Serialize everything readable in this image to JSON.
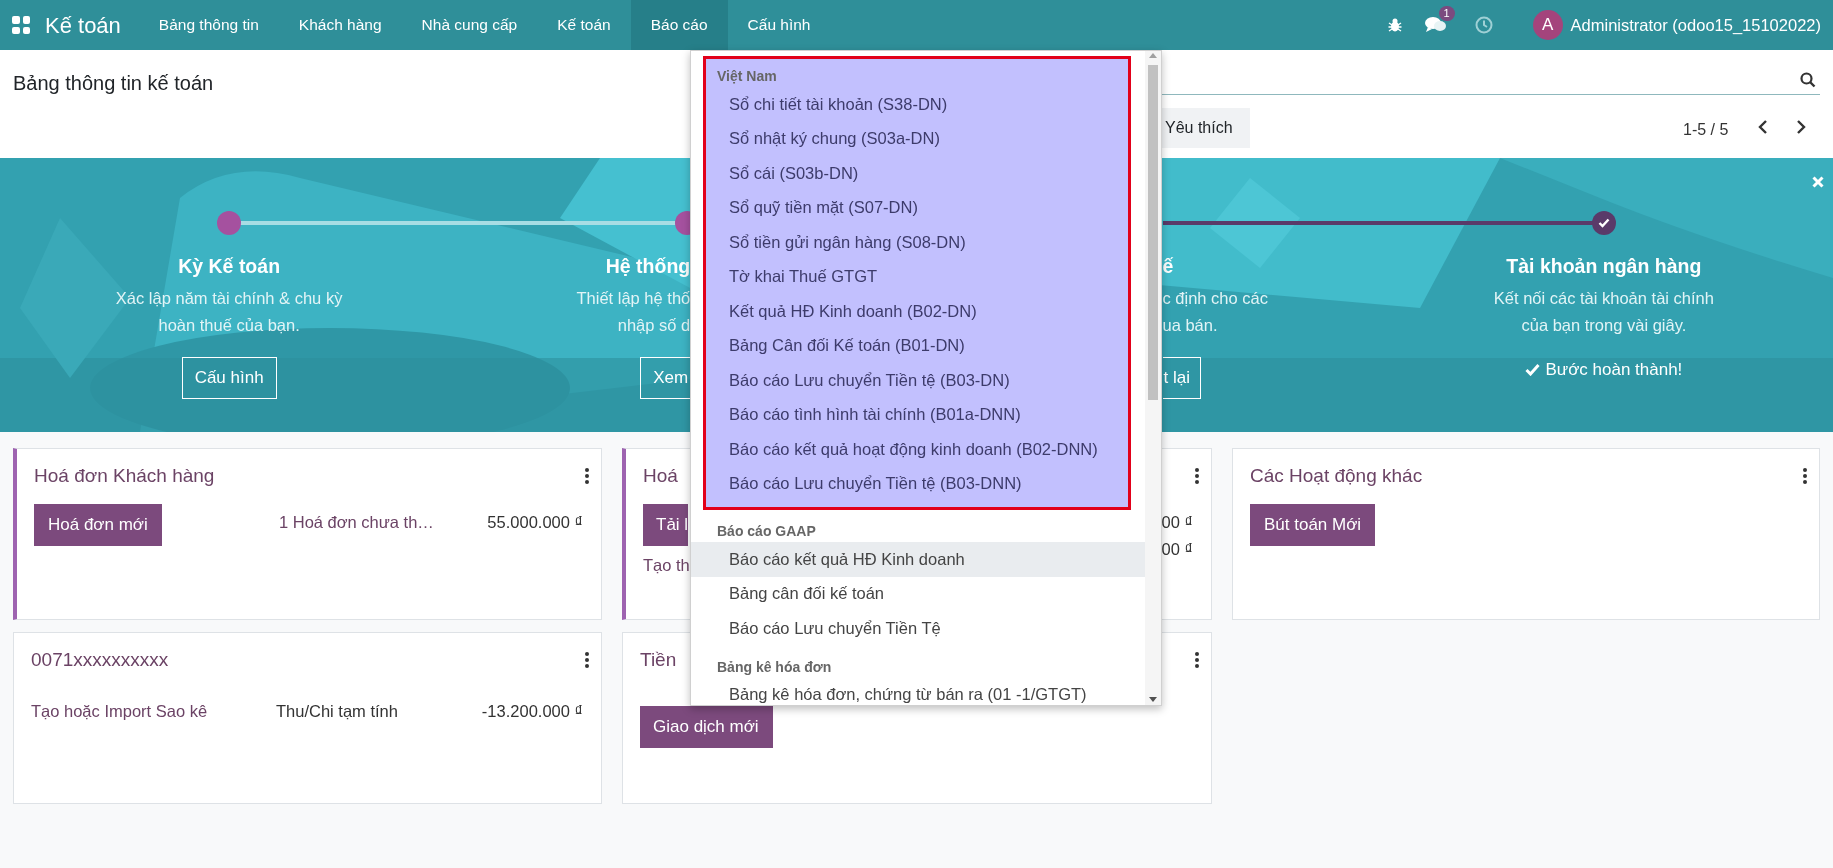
{
  "topbar": {
    "app_title": "Kế toán",
    "menu": [
      {
        "label": "Bảng thông tin",
        "selected": false
      },
      {
        "label": "Khách hàng",
        "selected": false
      },
      {
        "label": "Nhà cung cấp",
        "selected": false
      },
      {
        "label": "Kế toán",
        "selected": false
      },
      {
        "label": "Báo cáo",
        "selected": true
      },
      {
        "label": "Cấu hình",
        "selected": false
      }
    ],
    "message_count": "1",
    "avatar_letter": "A",
    "user": "Administrator (odoo15_15102022)"
  },
  "control_panel": {
    "title": "Bảng thông tin kế toán",
    "favorites": "Yêu thích",
    "pager": "1-5 / 5"
  },
  "banner": {
    "steps": [
      {
        "title": "Kỳ Kế toán",
        "lines": [
          "Xác lập năm tài chính & chu kỳ",
          "hoàn thuế của bạn."
        ],
        "button": "Cấu hình",
        "done": false
      },
      {
        "title": "Hệ thống",
        "lines": [
          "Thiết lập hệ thố",
          "nhập số d"
        ],
        "button": "Xem",
        "done": false,
        "clipped_right": true
      },
      {
        "title": "ế",
        "lines": [
          "c định cho các",
          "ua bán."
        ],
        "button": "t lại",
        "clipped_left": true
      },
      {
        "title": "Tài khoản ngân hàng",
        "lines": [
          "Kết nối các tài khoản tài chính",
          "của bạn trong vài giây."
        ],
        "done_text": "Bước hoàn thành!",
        "done": true
      }
    ]
  },
  "cards": [
    {
      "title": "Hoá đơn Khách hàng",
      "accent": true,
      "button": "Hoá đơn mới",
      "rows": [
        {
          "label": "1 Hoá đơn chưa th…",
          "amount": "55.000.000 ₫"
        }
      ]
    },
    {
      "title": "Hoá",
      "accent": true,
      "button": "Tải l",
      "link": "Tạo th",
      "rows": [
        {
          "amount": "00 ₫"
        },
        {
          "amount": "00 ₫"
        }
      ],
      "clipped_right": true
    },
    {
      "title": "Các Hoạt động khác",
      "accent": false,
      "button": "Bút toán Mới"
    },
    {
      "title": "0071xxxxxxxxxx",
      "accent": false,
      "link": "Tạo hoặc Import Sao kê",
      "rows": [
        {
          "label": "Thu/Chi tạm tính",
          "amount": "-13.200.000 ₫"
        }
      ]
    },
    {
      "title": "Tiền",
      "accent": false,
      "button": "Giao dịch mới",
      "clipped_right": true
    }
  ],
  "dropdown": {
    "sections": [
      {
        "header": "Việt Nam",
        "highlighted": true,
        "items": [
          {
            "label": "Sổ chi tiết tài khoản (S38-DN)",
            "hovered": false
          },
          {
            "label": "Sổ nhật ký chung (S03a-DN)",
            "hovered": false
          },
          {
            "label": "Sổ cái (S03b-DN)",
            "hovered": false
          },
          {
            "label": "Sổ quỹ tiền mặt (S07-DN)",
            "hovered": false
          },
          {
            "label": "Sổ tiền gửi ngân hàng (S08-DN)",
            "hovered": false
          },
          {
            "label": "Tờ khai Thuế GTGT",
            "hovered": false
          },
          {
            "label": "Kết quả HĐ Kinh doanh (B02-DN)",
            "hovered": false
          },
          {
            "label": "Bảng Cân đối Kế toán (B01-DN)",
            "hovered": false
          },
          {
            "label": "Báo cáo Lưu chuyển Tiền tệ (B03-DN)",
            "hovered": false
          },
          {
            "label": "Báo cáo tình hình tài chính (B01a-DNN)",
            "hovered": false
          },
          {
            "label": "Báo cáo kết quả hoạt động kinh doanh (B02-DNN)",
            "hovered": false
          },
          {
            "label": "Báo cáo Lưu chuyển Tiền tệ (B03-DNN)",
            "hovered": false
          }
        ]
      },
      {
        "header": "Báo cáo GAAP",
        "highlighted": false,
        "items": [
          {
            "label": "Báo cáo kết quả HĐ Kinh doanh",
            "hovered": true
          },
          {
            "label": "Bảng cân đối kế toán",
            "hovered": false
          },
          {
            "label": "Báo cáo Lưu chuyển Tiền Tệ",
            "hovered": false
          }
        ]
      },
      {
        "header": "Bảng kê hóa đơn",
        "highlighted": false,
        "items": [
          {
            "label": "Bảng kê hóa đơn, chứng từ bán ra (01 -1/GTGT)",
            "hovered": false
          }
        ]
      }
    ]
  }
}
